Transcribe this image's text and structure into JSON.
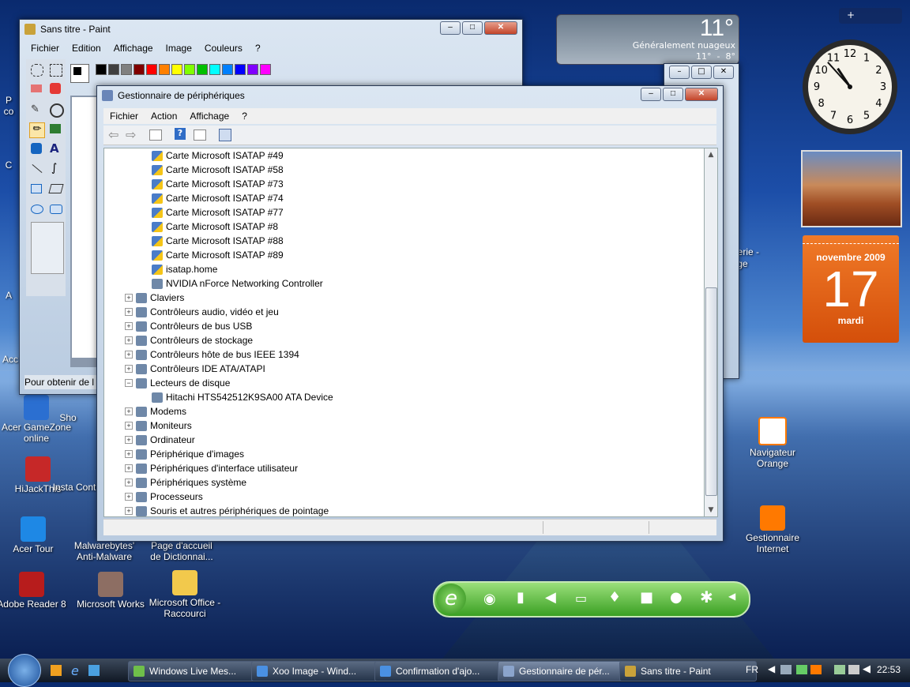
{
  "paint": {
    "title": "Sans titre - Paint",
    "menu": [
      "Fichier",
      "Edition",
      "Affichage",
      "Image",
      "Couleurs",
      "?"
    ],
    "status": "Pour obtenir de l",
    "palette": [
      "#000000",
      "#404040",
      "#808080",
      "#800000",
      "#ff0000",
      "#ff8000",
      "#ffff00",
      "#80ff00",
      "#00c000",
      "#00ffff",
      "#0080ff",
      "#0000ff",
      "#8000ff",
      "#ff00ff"
    ]
  },
  "devmgr": {
    "title": "Gestionnaire de périphériques",
    "menu": [
      "Fichier",
      "Action",
      "Affichage",
      "?"
    ],
    "items": [
      {
        "label": "Carte Microsoft ISATAP #49",
        "level": 2,
        "warn": true
      },
      {
        "label": "Carte Microsoft ISATAP #58",
        "level": 2,
        "warn": true
      },
      {
        "label": "Carte Microsoft ISATAP #73",
        "level": 2,
        "warn": true
      },
      {
        "label": "Carte Microsoft ISATAP #74",
        "level": 2,
        "warn": true
      },
      {
        "label": "Carte Microsoft ISATAP #77",
        "level": 2,
        "warn": true
      },
      {
        "label": "Carte Microsoft ISATAP #8",
        "level": 2,
        "warn": true
      },
      {
        "label": "Carte Microsoft ISATAP #88",
        "level": 2,
        "warn": true
      },
      {
        "label": "Carte Microsoft ISATAP #89",
        "level": 2,
        "warn": true
      },
      {
        "label": "isatap.home",
        "level": 2,
        "warn": true
      },
      {
        "label": "NVIDIA nForce Networking Controller",
        "level": 2,
        "warn": false
      },
      {
        "label": "Claviers",
        "level": 1,
        "exp": "+"
      },
      {
        "label": "Contrôleurs audio, vidéo et jeu",
        "level": 1,
        "exp": "+"
      },
      {
        "label": "Contrôleurs de bus USB",
        "level": 1,
        "exp": "+"
      },
      {
        "label": "Contrôleurs de stockage",
        "level": 1,
        "exp": "+"
      },
      {
        "label": "Contrôleurs hôte de bus IEEE 1394",
        "level": 1,
        "exp": "+"
      },
      {
        "label": "Contrôleurs IDE ATA/ATAPI",
        "level": 1,
        "exp": "+"
      },
      {
        "label": "Lecteurs de disque",
        "level": 1,
        "exp": "−"
      },
      {
        "label": "Hitachi HTS542512K9SA00 ATA Device",
        "level": 2,
        "warn": false
      },
      {
        "label": "Modems",
        "level": 1,
        "exp": "+"
      },
      {
        "label": "Moniteurs",
        "level": 1,
        "exp": "+"
      },
      {
        "label": "Ordinateur",
        "level": 1,
        "exp": "+"
      },
      {
        "label": "Périphérique d'images",
        "level": 1,
        "exp": "+"
      },
      {
        "label": "Périphériques d'interface utilisateur",
        "level": 1,
        "exp": "+"
      },
      {
        "label": "Périphériques système",
        "level": 1,
        "exp": "+"
      },
      {
        "label": "Processeurs",
        "level": 1,
        "exp": "+"
      },
      {
        "label": "Souris et autres périphériques de pointage",
        "level": 1,
        "exp": "+"
      }
    ]
  },
  "weather": {
    "temp": "11°",
    "desc": "Généralement nuageux",
    "range": "11°  -  8°"
  },
  "calendar": {
    "month": "novembre 2009",
    "day": "17",
    "weekday": "mardi"
  },
  "clock": {
    "hour": 10,
    "minute": 53
  },
  "desktop_icons": [
    {
      "label": "Acer GameZone online",
      "color": "#2b6fd1"
    },
    {
      "label": "HiJackThis",
      "color": "#c62828"
    },
    {
      "label": "Acer Tour",
      "color": "#1e88e5"
    },
    {
      "label": "Adobe Reader 8",
      "color": "#b71c1c"
    },
    {
      "label": "Microsoft Works",
      "color": "#8d6e63"
    },
    {
      "label": "Microsoft Office - Raccourci",
      "color": "#f2c94c"
    },
    {
      "label": "Malwarebytes' Anti-Malware",
      "color": "#1565c0"
    },
    {
      "label": "Page d'accueil de Dictionnai...",
      "color": "#6d4c41"
    },
    {
      "label": "Navigateur Orange",
      "color": "#ff7900"
    },
    {
      "label": "Gestionnaire Internet",
      "color": "#ff7900"
    }
  ],
  "partial_labels": {
    "show": "Sho",
    "insta": "Insta Cont",
    "gerie": "gerie -",
    "ge": "ge",
    "p": "P",
    "co": "co",
    "c": "C",
    "a": "A",
    "acc": "Acc"
  },
  "taskbar": {
    "tasks": [
      "Windows Live Mes...",
      "Xoo Image - Wind...",
      "Confirmation d'ajo...",
      "Gestionnaire de pér...",
      "Sans titre - Paint"
    ],
    "lang": "FR",
    "time": "22:53"
  }
}
